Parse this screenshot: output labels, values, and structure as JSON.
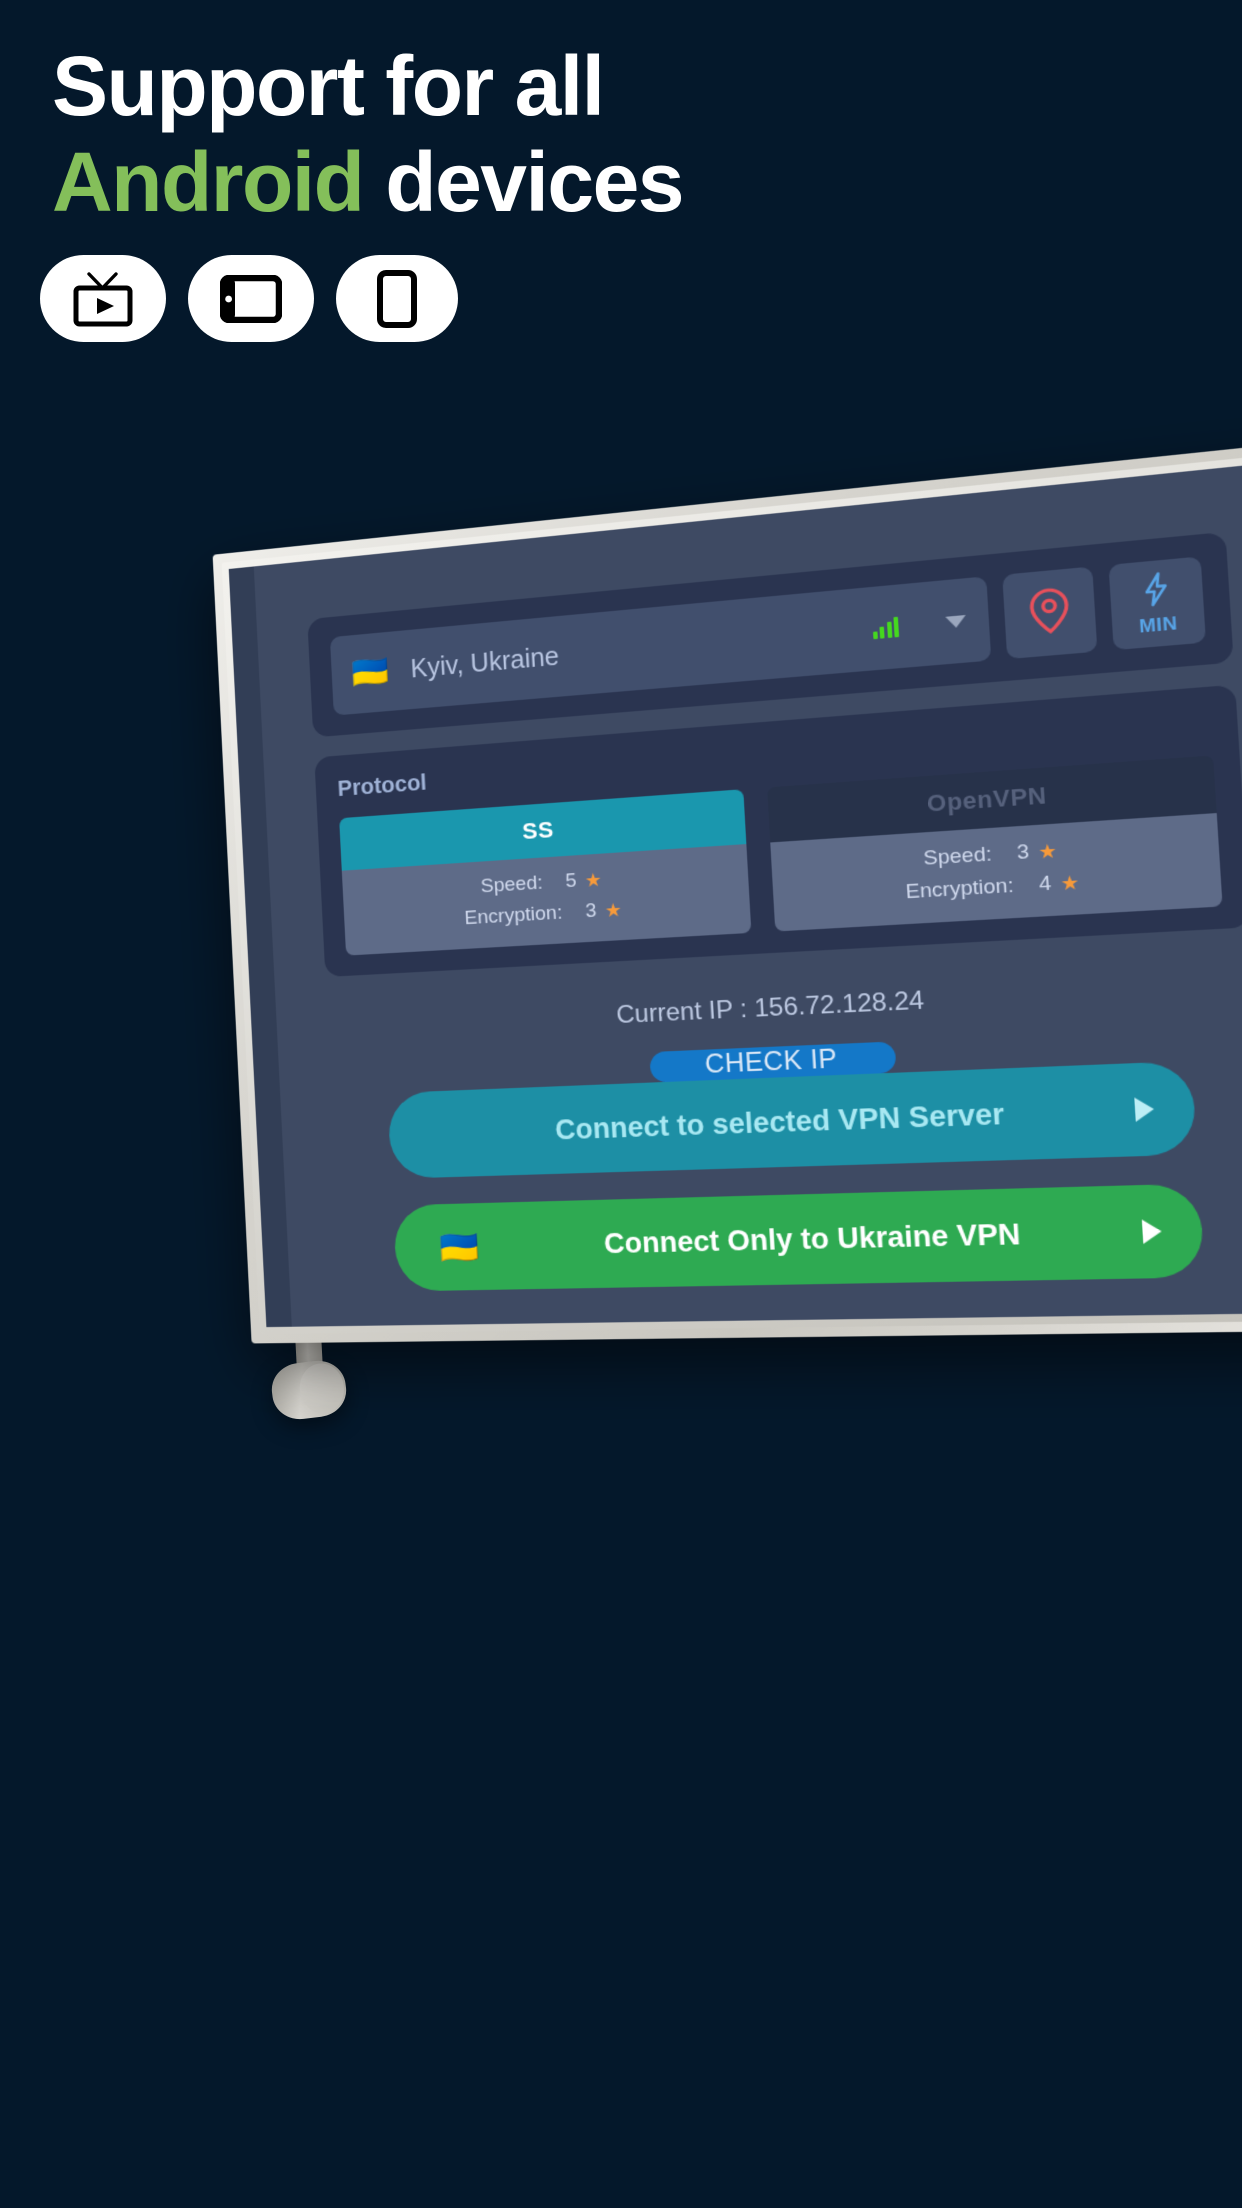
{
  "theme": {
    "page_background": "#04182b",
    "accent_green": "#84bf5a",
    "screen_background": "#3e4a63",
    "card_background": "#2a3450",
    "teal": "#1d8fa5",
    "green_button": "#2eaa52",
    "blue_button": "#1478c8",
    "star_orange": "#f79a3a",
    "pin_red": "#e8505b",
    "signal_green": "#45d81f"
  },
  "headline": {
    "line1": "Support for all",
    "line2_accent": "Android",
    "line2_rest": " devices"
  },
  "devices": [
    {
      "name": "tv-icon",
      "label": "TV"
    },
    {
      "name": "tablet-icon",
      "label": "Tablet"
    },
    {
      "name": "phone-icon",
      "label": "Phone"
    }
  ],
  "app": {
    "location": {
      "flag": "🇺🇦",
      "name": "Kyiv, Ukraine",
      "signal_bars": 4,
      "dropdown_icon": "chevron-down-icon",
      "pin_button_icon": "map-pin-icon",
      "boost_button": {
        "icon": "lightning-bolt-icon",
        "label": "MIN"
      }
    },
    "protocol": {
      "title": "Protocol",
      "options": [
        {
          "name": "SS",
          "selected": true,
          "stats": [
            {
              "label": "Speed:",
              "value": "5",
              "star": "★"
            },
            {
              "label": "Encryption:",
              "value": "3",
              "star": "★"
            }
          ]
        },
        {
          "name": "OpenVPN",
          "selected": false,
          "stats": [
            {
              "label": "Speed:",
              "value": "3",
              "star": "★"
            },
            {
              "label": "Encryption:",
              "value": "4",
              "star": "★"
            }
          ]
        }
      ]
    },
    "ip": {
      "current_ip_text": "Current IP : 156.72.128.24",
      "check_button": "CHECK IP"
    },
    "connect": {
      "primary_label": "Connect to selected VPN Server",
      "secondary_label": "Connect Only to Ukraine VPN",
      "secondary_flag": "🇺🇦",
      "arrow_icon": "play-arrow-icon"
    }
  }
}
